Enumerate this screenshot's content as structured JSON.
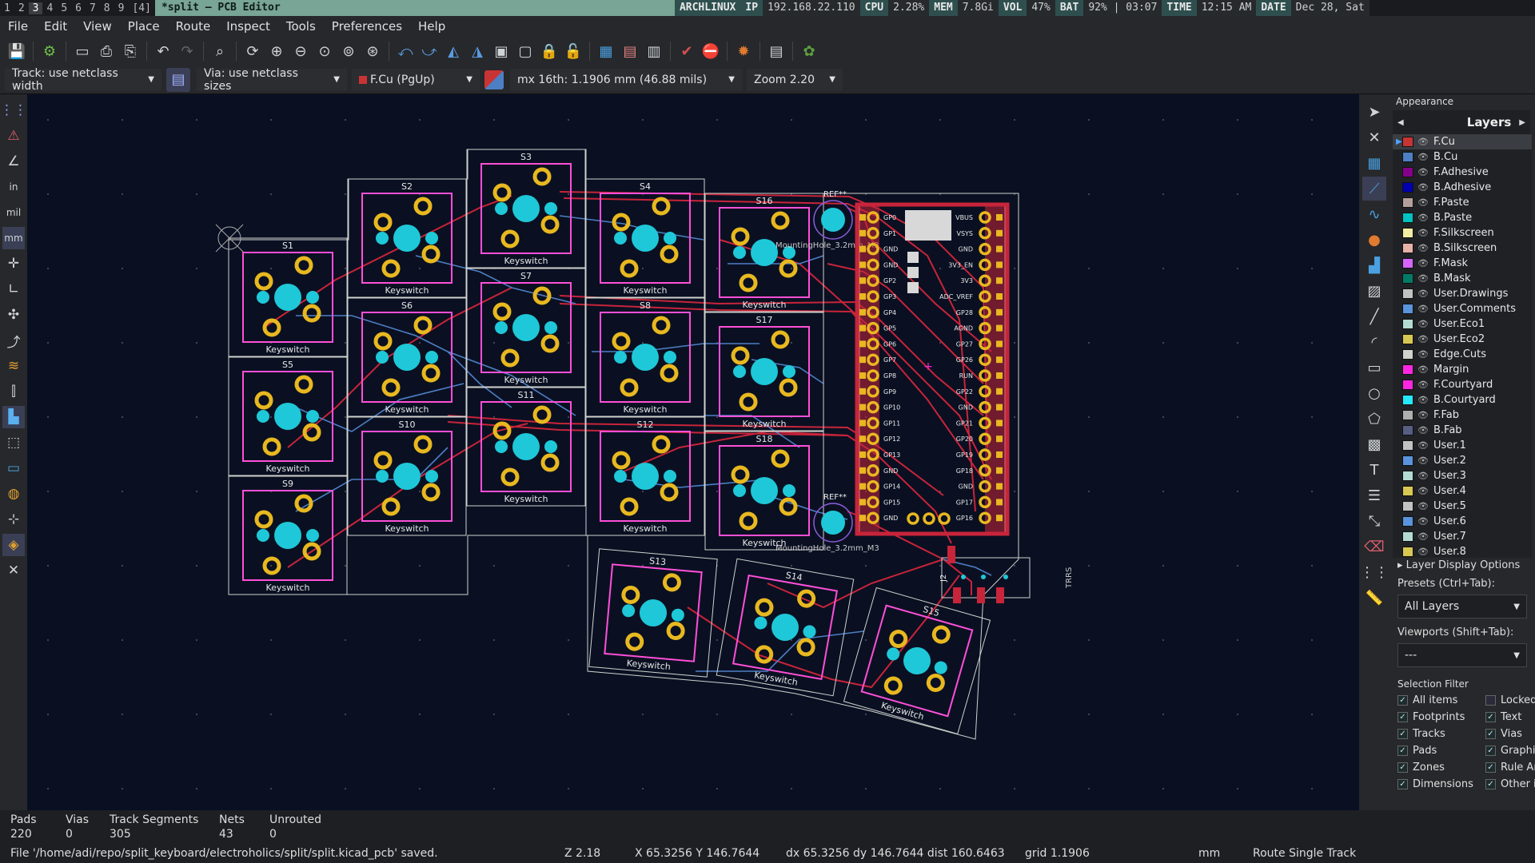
{
  "top_bar": {
    "workspaces": [
      "1",
      "2",
      "3",
      "4",
      "5",
      "6",
      "7",
      "8",
      "9",
      "[4]"
    ],
    "active_workspace": "3",
    "window_title": "*split — PCB Editor",
    "status_items": [
      {
        "label": "ARCHLINUX",
        "value": ""
      },
      {
        "label": "IP",
        "value": "192.168.22.110"
      },
      {
        "label": "CPU",
        "value": "2.28%"
      },
      {
        "label": "MEM",
        "value": "7.8Gi"
      },
      {
        "label": "VOL",
        "value": "47%"
      },
      {
        "label": "BAT",
        "value": "92% | 03:07"
      },
      {
        "label": "TIME",
        "value": "12:15 AM"
      },
      {
        "label": "DATE",
        "value": "Dec 28, Sat"
      }
    ]
  },
  "menu": [
    "File",
    "Edit",
    "View",
    "Place",
    "Route",
    "Inspect",
    "Tools",
    "Preferences",
    "Help"
  ],
  "toolbar2": {
    "track": "Track: use netclass width",
    "via": "Via: use netclass sizes",
    "layer": "F.Cu (PgUp)",
    "grid": "mx 16th: 1.1906 mm (46.88 mils)",
    "zoom": "Zoom 2.20"
  },
  "board": {
    "switches": [
      "S1",
      "S2",
      "S3",
      "S4",
      "S5",
      "S6",
      "S7",
      "S8",
      "S9",
      "S10",
      "S11",
      "S12",
      "S13",
      "S14",
      "S15",
      "S16",
      "S17",
      "S18"
    ],
    "footprint_label": "Keyswitch",
    "mounting_hole_label": "MountingHole_3.2mm_M3",
    "mounting_hole_ref": "REF**",
    "mcu_pins_left": [
      "GP0",
      "GP1",
      "GND",
      "GND",
      "GP2",
      "GP3",
      "GP4",
      "GP5",
      "GP6",
      "GP7",
      "GP8",
      "GP9",
      "GP10",
      "GP11",
      "GP12",
      "GP13",
      "GND",
      "GP14",
      "GP15",
      "GND"
    ],
    "mcu_pins_right": [
      "VBUS",
      "VSYS",
      "GND",
      "3V3_EN",
      "3V3",
      "ADC_VREF",
      "GP28",
      "AGND",
      "GP27",
      "GP26",
      "RUN",
      "GP22",
      "GND",
      "GP21",
      "GP20",
      "GP19",
      "GP18",
      "GND",
      "GP17",
      "GP16"
    ],
    "connector_ref": "J2",
    "trrs_label": "TRRS"
  },
  "appearance": {
    "title": "Appearance",
    "tab": "Layers",
    "layers": [
      {
        "name": "F.Cu",
        "color": "#c83434",
        "selected": true
      },
      {
        "name": "B.Cu",
        "color": "#4d7fc4",
        "selected": false
      },
      {
        "name": "F.Adhesive",
        "color": "#84008a",
        "selected": false
      },
      {
        "name": "B.Adhesive",
        "color": "#0000b0",
        "selected": false
      },
      {
        "name": "F.Paste",
        "color": "#b4a09a",
        "selected": false
      },
      {
        "name": "B.Paste",
        "color": "#00c2c2",
        "selected": false
      },
      {
        "name": "F.Silkscreen",
        "color": "#f2eda1",
        "selected": false
      },
      {
        "name": "B.Silkscreen",
        "color": "#e8b2a7",
        "selected": false
      },
      {
        "name": "F.Mask",
        "color": "#d864ff",
        "selected": false
      },
      {
        "name": "B.Mask",
        "color": "#027a65",
        "selected": false
      },
      {
        "name": "User.Drawings",
        "color": "#c2c2c2",
        "selected": false
      },
      {
        "name": "User.Comments",
        "color": "#5994dc",
        "selected": false
      },
      {
        "name": "User.Eco1",
        "color": "#b4dbd2",
        "selected": false
      },
      {
        "name": "User.Eco2",
        "color": "#d8c852",
        "selected": false
      },
      {
        "name": "Edge.Cuts",
        "color": "#d0d2cd",
        "selected": false
      },
      {
        "name": "Margin",
        "color": "#ff26e2",
        "selected": false
      },
      {
        "name": "F.Courtyard",
        "color": "#ff26e2",
        "selected": false
      },
      {
        "name": "B.Courtyard",
        "color": "#26e9ff",
        "selected": false
      },
      {
        "name": "F.Fab",
        "color": "#afafaf",
        "selected": false
      },
      {
        "name": "B.Fab",
        "color": "#585d84",
        "selected": false
      },
      {
        "name": "User.1",
        "color": "#c2c2c2",
        "selected": false
      },
      {
        "name": "User.2",
        "color": "#5994dc",
        "selected": false
      },
      {
        "name": "User.3",
        "color": "#b4dbd2",
        "selected": false
      },
      {
        "name": "User.4",
        "color": "#d8c852",
        "selected": false
      },
      {
        "name": "User.5",
        "color": "#c2c2c2",
        "selected": false
      },
      {
        "name": "User.6",
        "color": "#5994dc",
        "selected": false
      },
      {
        "name": "User.7",
        "color": "#b4dbd2",
        "selected": false
      },
      {
        "name": "User.8",
        "color": "#d8c852",
        "selected": false
      }
    ],
    "layer_display_options": "Layer Display Options",
    "presets_label": "Presets (Ctrl+Tab):",
    "presets_value": "All Layers",
    "viewports_label": "Viewports (Shift+Tab):",
    "viewports_value": "---",
    "selection_filter_title": "Selection Filter",
    "selection_filter": [
      {
        "label": "All items",
        "checked": true
      },
      {
        "label": "Locked",
        "checked": false
      },
      {
        "label": "Footprints",
        "checked": true
      },
      {
        "label": "Text",
        "checked": true
      },
      {
        "label": "Tracks",
        "checked": true
      },
      {
        "label": "Vias",
        "checked": true
      },
      {
        "label": "Pads",
        "checked": true
      },
      {
        "label": "Graphic",
        "checked": true
      },
      {
        "label": "Zones",
        "checked": true
      },
      {
        "label": "Rule Ar",
        "checked": true
      },
      {
        "label": "Dimensions",
        "checked": true
      },
      {
        "label": "Other i",
        "checked": true
      }
    ]
  },
  "stats": [
    {
      "label": "Pads",
      "value": "220"
    },
    {
      "label": "Vias",
      "value": "0"
    },
    {
      "label": "Track Segments",
      "value": "305"
    },
    {
      "label": "Nets",
      "value": "43"
    },
    {
      "label": "Unrouted",
      "value": "0"
    }
  ],
  "status": {
    "message": "File '/home/adi/repo/split_keyboard/electroholics/split/split.kicad_pcb' saved.",
    "zoom": "Z 2.18",
    "xy": "X 65.3256  Y 146.7644",
    "delta": "dx 65.3256  dy 146.7644  dist 160.6463",
    "grid": "grid 1.1906",
    "units": "mm",
    "mode": "Route Single Track"
  }
}
